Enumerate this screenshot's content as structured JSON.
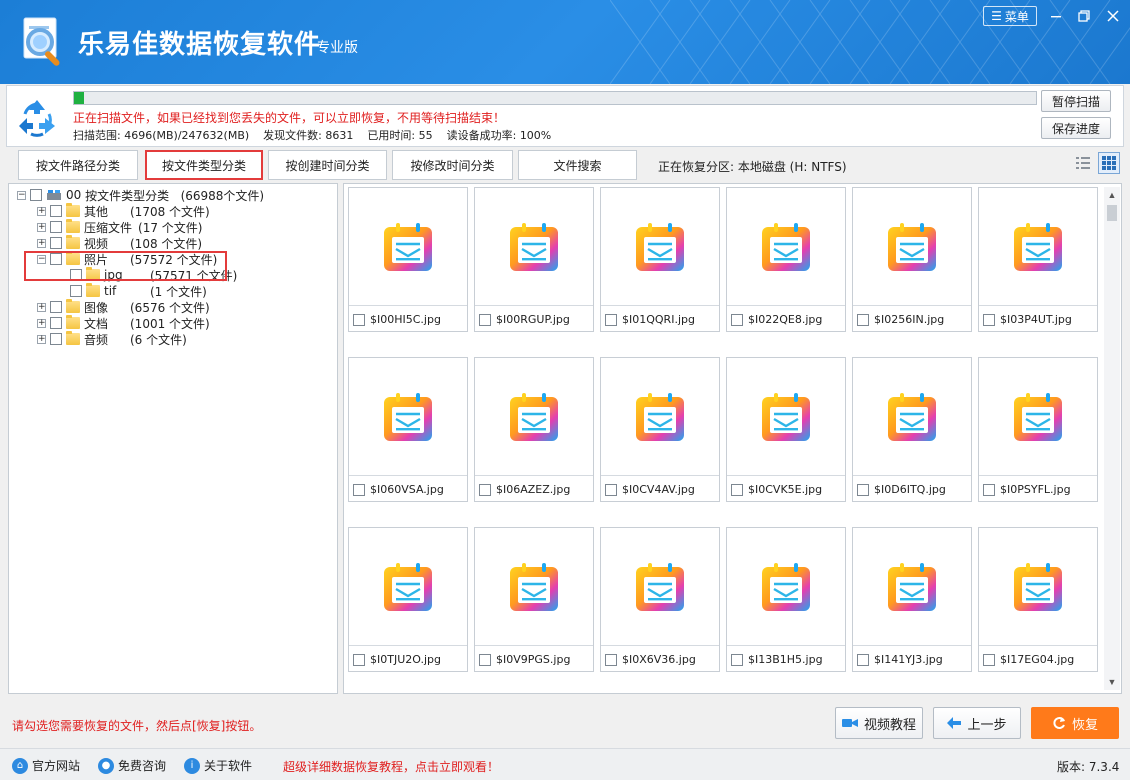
{
  "app": {
    "title": "乐易佳数据恢复软件",
    "edition": "专业版",
    "menu_label": "菜单"
  },
  "scan": {
    "progress_fraction": 0.01,
    "message": "正在扫描文件，如果已经找到您丢失的文件，可以立即恢复，不用等待扫描结束！",
    "range_label": "扫描范围:",
    "range_value": "4696(MB)/247632(MB)",
    "found_label": "发现文件数:",
    "found_value": "8631",
    "time_label": "已用时间:",
    "time_value": "55",
    "rate_label": "读设备成功率:",
    "rate_value": "100%",
    "pause_button": "暂停扫描",
    "save_button": "保存进度"
  },
  "tabs": [
    "按文件路径分类",
    "按文件类型分类",
    "按创建时间分类",
    "按修改时间分类",
    "文件搜索"
  ],
  "active_tab": 1,
  "partition": "正在恢复分区: 本地磁盘 (H: NTFS)",
  "tree": {
    "root": {
      "prefix": "00",
      "label": "按文件类型分类",
      "count": "(66988个文件)"
    },
    "items": [
      {
        "label": "其他",
        "count": "(1708 个文件)"
      },
      {
        "label": "压缩文件",
        "count": "(17 个文件)"
      },
      {
        "label": "视频",
        "count": "(108 个文件)"
      },
      {
        "label": "照片",
        "count": "(57572 个文件)"
      },
      {
        "label": "jpg",
        "count": "(57571 个文件)"
      },
      {
        "label": "tif",
        "count": "(1 个文件)"
      },
      {
        "label": "图像",
        "count": "(6576 个文件)"
      },
      {
        "label": "文档",
        "count": "(1001 个文件)"
      },
      {
        "label": "音频",
        "count": "(6 个文件)"
      }
    ]
  },
  "files": [
    "$I00HI5C.jpg",
    "$I00RGUP.jpg",
    "$I01QQRI.jpg",
    "$I022QE8.jpg",
    "$I0256IN.jpg",
    "$I03P4UT.jpg",
    "$I060VSA.jpg",
    "$I06AZEZ.jpg",
    "$I0CV4AV.jpg",
    "$I0CVK5E.jpg",
    "$I0D6ITQ.jpg",
    "$I0PSYFL.jpg",
    "$I0TJU2O.jpg",
    "$I0V9PGS.jpg",
    "$I0X6V36.jpg",
    "$I13B1H5.jpg",
    "$I141YJ3.jpg",
    "$I17EG04.jpg"
  ],
  "footer": {
    "hint": "请勾选您需要恢复的文件，然后点[恢复]按钮。",
    "video_button": "视频教程",
    "back_button": "上一步",
    "recover_button": "恢复",
    "official_site": "官方网站",
    "free_consult": "免费咨询",
    "about": "关于软件",
    "promo": "超级详细数据恢复教程，点击立即观看！",
    "version": "版本: 7.3.4"
  },
  "colors": {
    "titlebar": "#1c7ed6",
    "accent_red": "#e02020",
    "recover_orange": "#ff7a1a",
    "progress_green": "#1fb141"
  }
}
